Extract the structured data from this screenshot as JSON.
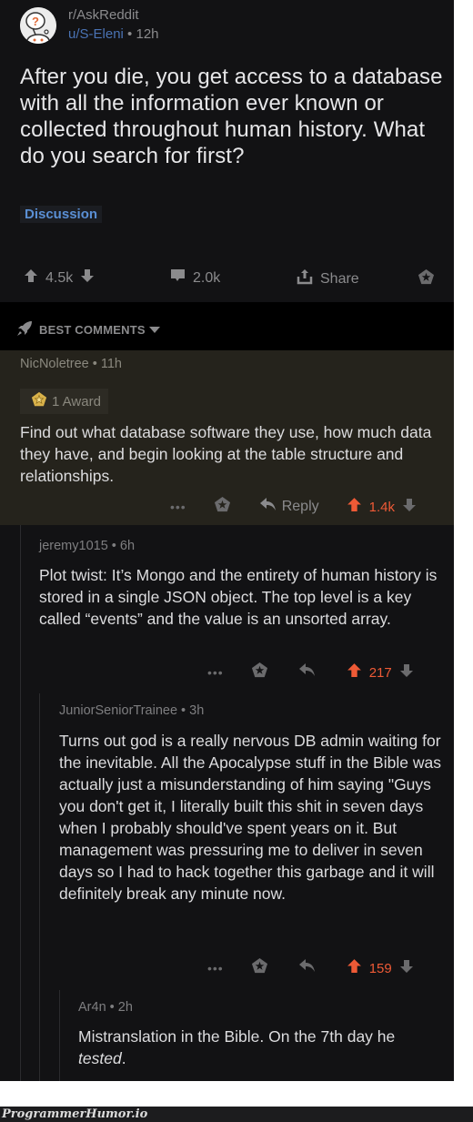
{
  "post": {
    "subreddit": "r/AskReddit",
    "author": "u/S-Eleni",
    "separator": "•",
    "age": "12h",
    "title": "After you die, you get access to a database with all the information ever known or collected throughout human history. What do you search for first?",
    "flair": "Discussion",
    "upvotes": "4.5k",
    "comments": "2.0k",
    "share_label": "Share"
  },
  "sort": {
    "label": "BEST COMMENTS"
  },
  "comments": [
    {
      "author": "NicNoletree",
      "age": "11h",
      "meta": "NicNoletree • 11h",
      "award": "1 Award",
      "body": "Find out what database software they use, how much data they have, and begin looking at the table structure and relationships.",
      "reply_label": "Reply",
      "score": "1.4k",
      "upvoted": true,
      "highlighted": true
    },
    {
      "author": "jeremy1015",
      "age": "6h",
      "meta": "jeremy1015 • 6h",
      "body": "Plot twist: It’s Mongo and the entirety of human history is stored in a single JSON object. The top level is a key called “events” and the value is an unsorted array.",
      "score": "217",
      "upvoted": true
    },
    {
      "author": "JuniorSeniorTrainee",
      "age": "3h",
      "meta": "JuniorSeniorTrainee • 3h",
      "body": "Turns out god is a really nervous DB admin waiting for the inevitable. All the Apocalypse stuff in the Bible was actually just a misunderstanding of him saying \"Guys you don't get it, I literally built this shit in seven days when I probably should've spent years on it. But management was pressuring me to deliver in seven days so I had to hack together this garbage and it will definitely break any minute now.",
      "score": "159",
      "upvoted": true
    },
    {
      "author": "Ar4n",
      "age": "2h",
      "meta": "Ar4n • 2h",
      "body_prefix": "Mistranslation in the Bible. On the 7th day he ",
      "body_emphasis": "tested",
      "body_suffix": "."
    }
  ],
  "watermark": "ProgrammerHumor.io",
  "colors": {
    "background": "#121214",
    "highlight": "#25231c",
    "upvote_active": "#ee5a36",
    "flair": "#5a8fd4",
    "username": "#4a73b4"
  }
}
